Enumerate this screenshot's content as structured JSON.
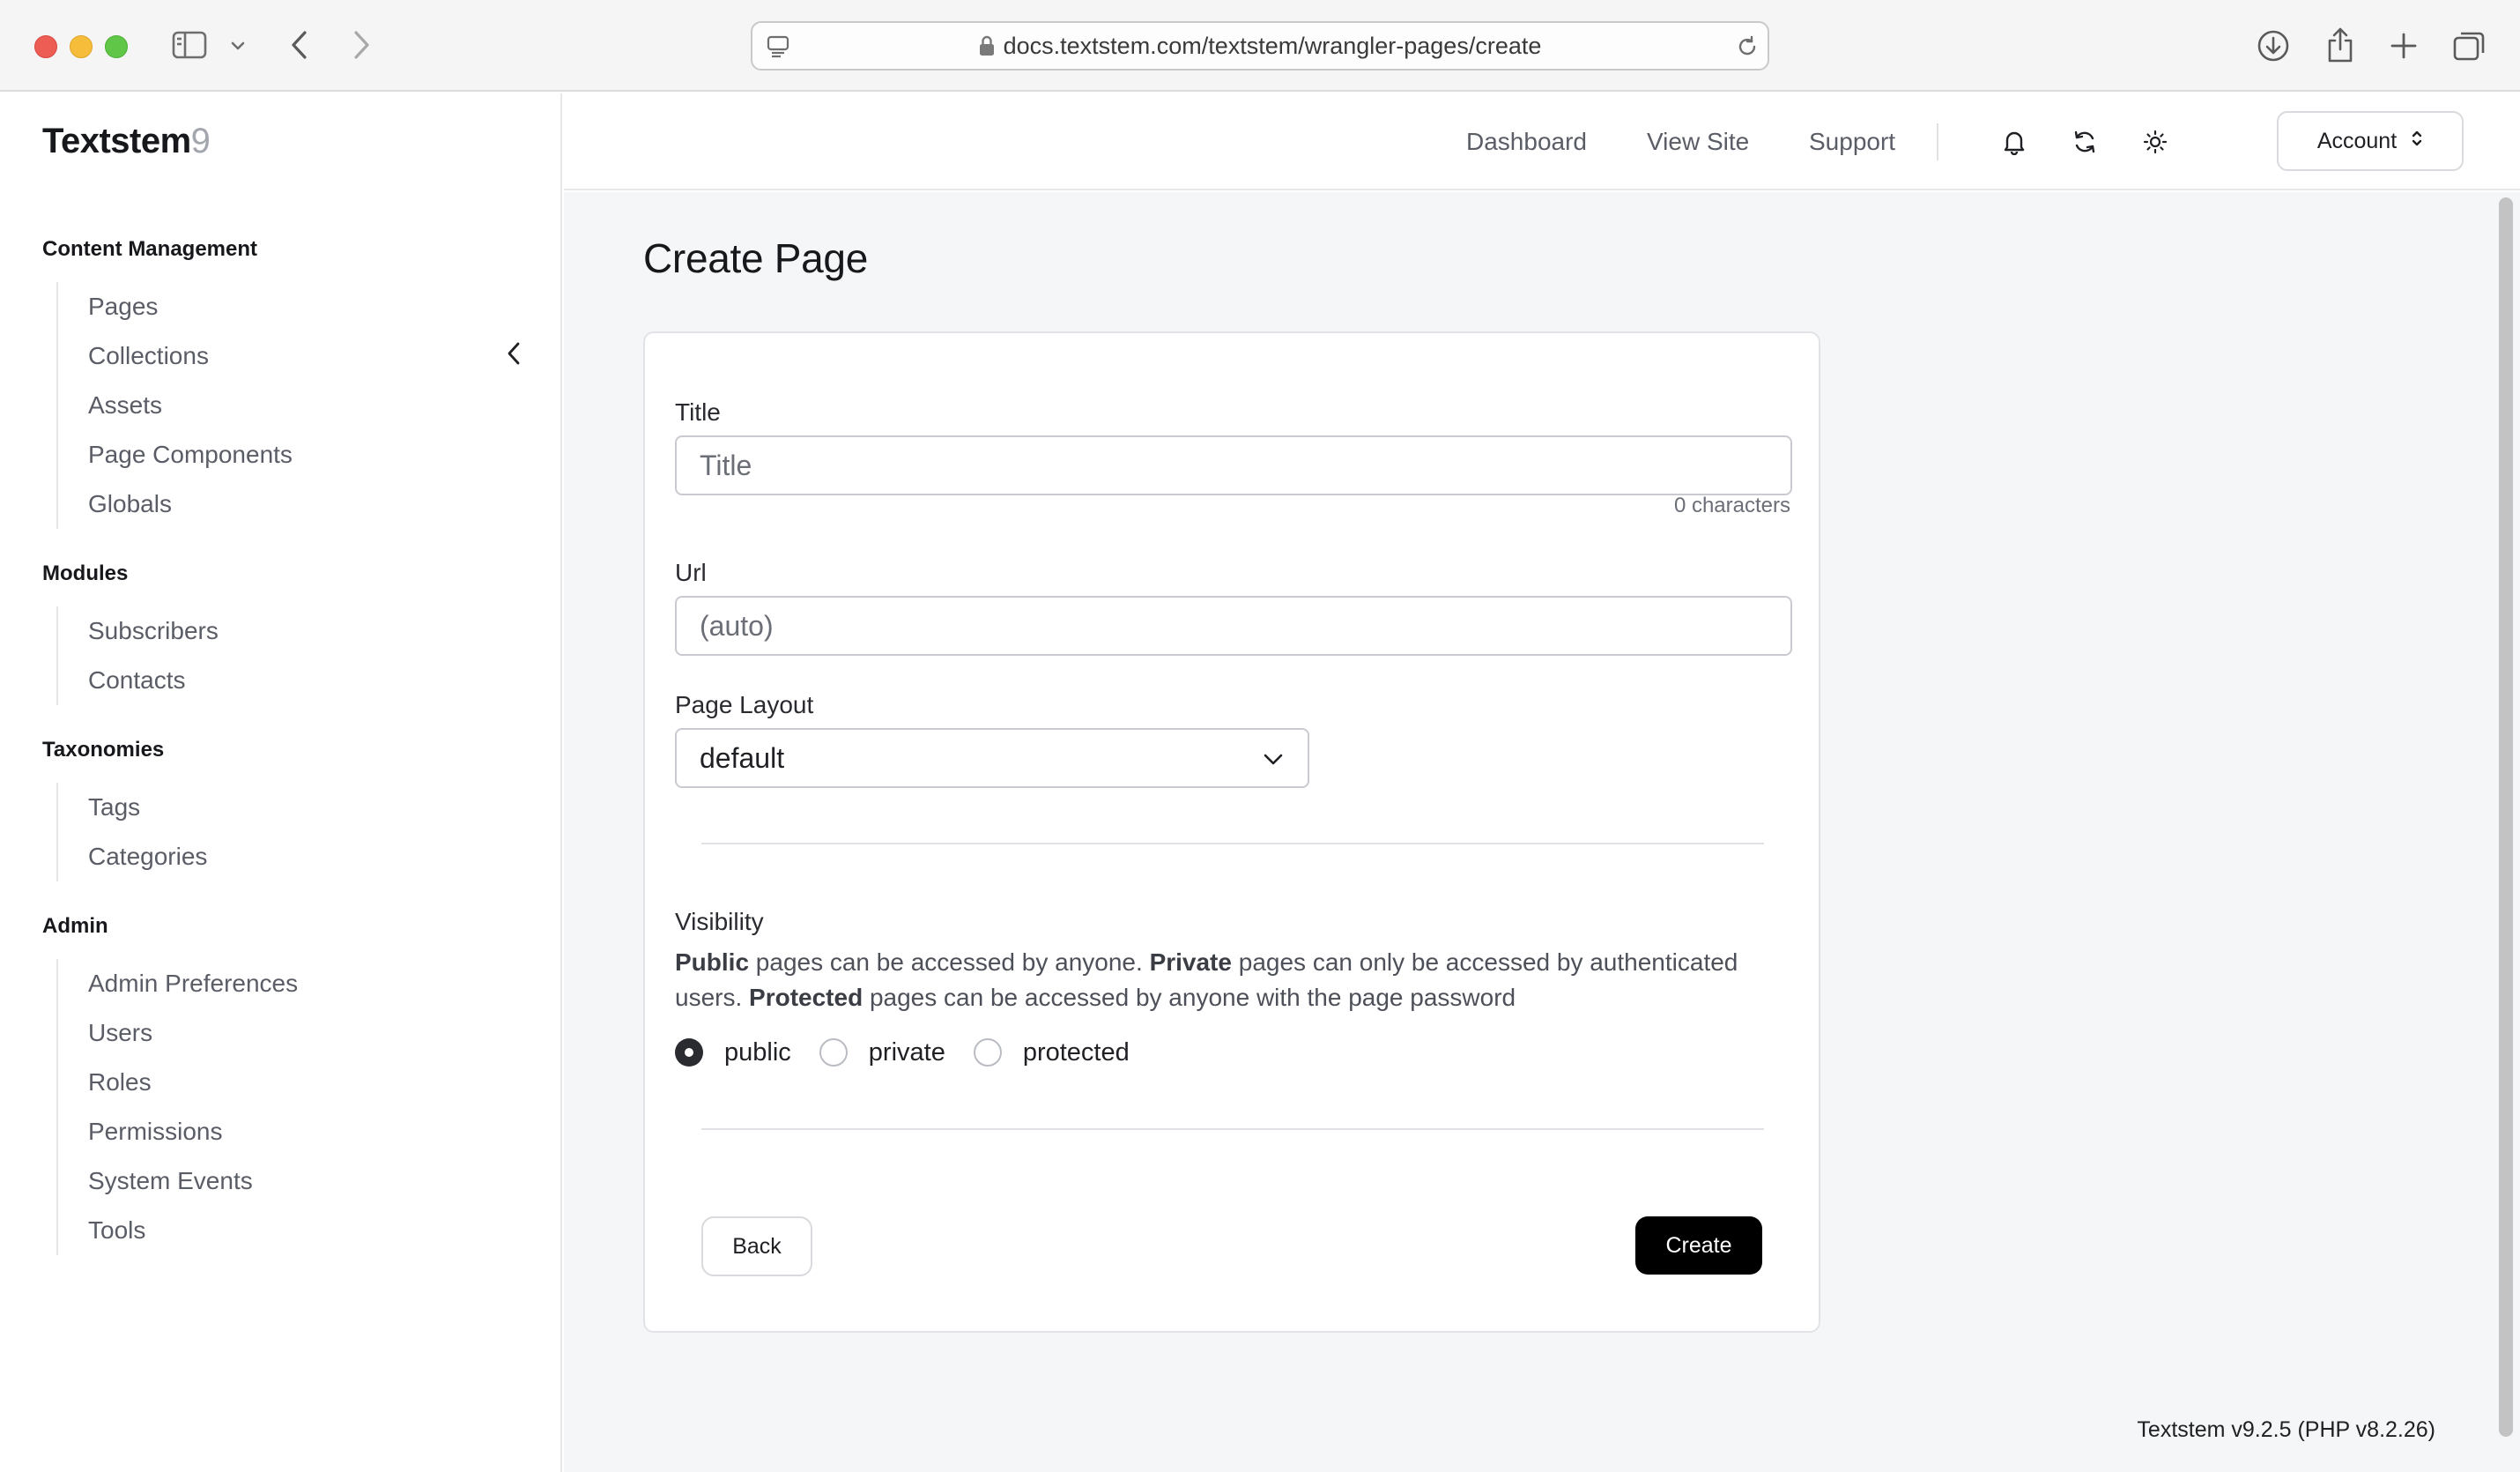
{
  "browser": {
    "url": "docs.textstem.com/textstem/wrangler-pages/create"
  },
  "sidebar": {
    "brand": "Textstem",
    "brand_version": "9",
    "groups": [
      {
        "heading": "Content Management",
        "items": [
          "Pages",
          "Collections",
          "Assets",
          "Page Components",
          "Globals"
        ]
      },
      {
        "heading": "Modules",
        "items": [
          "Subscribers",
          "Contacts"
        ]
      },
      {
        "heading": "Taxonomies",
        "items": [
          "Tags",
          "Categories"
        ]
      },
      {
        "heading": "Admin",
        "items": [
          "Admin Preferences",
          "Users",
          "Roles",
          "Permissions",
          "System Events",
          "Tools"
        ]
      }
    ]
  },
  "topbar": {
    "links": [
      "Dashboard",
      "View Site",
      "Support"
    ],
    "account_label": "Account"
  },
  "page": {
    "title": "Create Page"
  },
  "form": {
    "title_label": "Title",
    "title_placeholder": "Title",
    "title_value": "",
    "char_count": "0 characters",
    "url_label": "Url",
    "url_placeholder": "(auto)",
    "layout_label": "Page Layout",
    "layout_value": "default",
    "visibility_label": "Visibility",
    "visibility_desc": {
      "public_bold": "Public",
      "public_text": " pages can be accessed by anyone. ",
      "private_bold": "Private",
      "private_text": " pages can only be accessed by authenticated users. ",
      "protected_bold": "Protected",
      "protected_text": " pages can be accessed by anyone with the page password"
    },
    "visibility_options": [
      "public",
      "private",
      "protected"
    ],
    "visibility_selected": "public",
    "back_label": "Back",
    "create_label": "Create"
  },
  "footer": {
    "version": "Textstem v9.2.5 (PHP v8.2.26)"
  }
}
